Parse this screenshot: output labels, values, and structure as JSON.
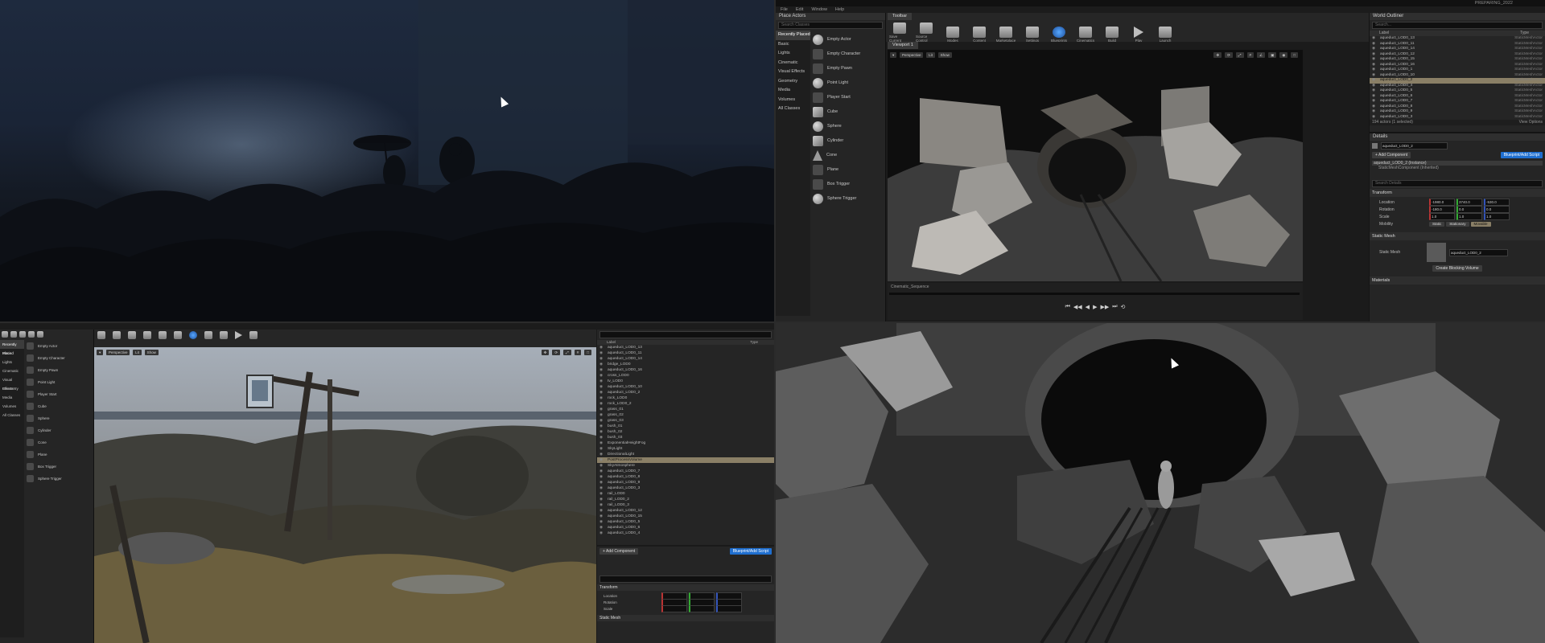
{
  "top_right": {
    "window_tab": "PREPARING_2022",
    "menu": [
      "File",
      "Edit",
      "Window",
      "Help"
    ],
    "place_actors": {
      "title": "Place Actors",
      "search_placeholder": "Search Classes",
      "categories": [
        "Recently Placed",
        "Basic",
        "Lights",
        "Cinematic",
        "Visual Effects",
        "Geometry",
        "Media",
        "Volumes",
        "All Classes"
      ],
      "selected_category": "Recently Placed",
      "items": [
        {
          "label": "Empty Actor",
          "icon": "actor"
        },
        {
          "label": "Empty Character",
          "icon": "character"
        },
        {
          "label": "Empty Pawn",
          "icon": "pawn"
        },
        {
          "label": "Point Light",
          "icon": "light"
        },
        {
          "label": "Player Start",
          "icon": "player"
        },
        {
          "label": "Cube",
          "icon": "cube"
        },
        {
          "label": "Sphere",
          "icon": "sphere"
        },
        {
          "label": "Cylinder",
          "icon": "cylinder"
        },
        {
          "label": "Cone",
          "icon": "cone"
        },
        {
          "label": "Plane",
          "icon": "plane"
        },
        {
          "label": "Box Trigger",
          "icon": "box"
        },
        {
          "label": "Sphere Trigger",
          "icon": "sphere"
        }
      ]
    },
    "toolbar": {
      "tab": "Toolbar",
      "buttons": [
        "Save Current",
        "Source Control",
        "Modes",
        "Content",
        "Marketplace",
        "Settings",
        "Blueprints",
        "Cinematics",
        "Build",
        "Play",
        "Launch"
      ]
    },
    "viewport": {
      "tab": "Viewport 1",
      "perspective": "Perspective",
      "lit": "Lit",
      "show": "Show",
      "sequence_name": "Cinematic_Sequence",
      "controls": [
        "⏮",
        "◀◀",
        "◀",
        "▶",
        "▶▶",
        "⏭",
        "⟲"
      ]
    },
    "outliner": {
      "title": "World Outliner",
      "search_placeholder": "Search...",
      "col_label": "Label",
      "col_type": "Type",
      "rows": [
        "aqueduct_LOD0_13",
        "aqueduct_LOD0_11",
        "aqueduct_LOD0_14",
        "aqueduct_LOD0_12",
        "aqueduct_LOD0_15",
        "aqueduct_LOD0_16",
        "aqueduct_LOD0_1",
        "aqueduct_LOD0_10",
        "aqueduct_LOD0_2",
        "aqueduct_LOD0_4",
        "aqueduct_LOD0_5",
        "aqueduct_LOD0_6",
        "aqueduct_LOD0_7",
        "aqueduct_LOD0_8",
        "aqueduct_LOD0_9",
        "aqueduct_LOD0_3"
      ],
      "row_type": "StaticMeshActor",
      "selected_index": 8,
      "footer": "194 actors (1 selected)",
      "view_options": "View Options"
    },
    "details": {
      "title": "Details",
      "actor_name": "aqueduct_LOD0_2",
      "add_component": "+ Add Component",
      "blueprint": "Blueprint/Add Script",
      "component_root": "aqueduct_LOD0_2 (Instance)",
      "component_child": "StaticMeshComponent (Inherited)",
      "search_placeholder": "Search Details",
      "transform_title": "Transform",
      "location_label": "Location",
      "rotation_label": "Rotation",
      "scale_label": "Scale",
      "mobility_label": "Mobility",
      "location": [
        "-1980.0",
        "3740.0",
        "-530.0"
      ],
      "rotation": [
        "-180.0",
        "0.0",
        "0.0"
      ],
      "scale": [
        "1.0",
        "1.0",
        "1.0"
      ],
      "mobility_options": [
        "Static",
        "Stationary",
        "Movable"
      ],
      "static_mesh_title": "Static Mesh",
      "static_mesh_label": "Static Mesh",
      "static_mesh_value": "aqueduct_LOD0_2",
      "create_blocking": "Create Blocking Volume",
      "materials_title": "Materials"
    }
  },
  "bottom_left": {
    "categories": [
      "Recently Placed",
      "Basic",
      "Lights",
      "Cinematic",
      "Visual Effects",
      "Geometry",
      "Media",
      "Volumes",
      "All Classes"
    ],
    "items": [
      "Empty Actor",
      "Empty Character",
      "Empty Pawn",
      "Point Light",
      "Player Start",
      "Cube",
      "Sphere",
      "Cylinder",
      "Cone",
      "Plane",
      "Box Trigger",
      "Sphere Trigger"
    ],
    "viewport_perspective": "Perspective",
    "viewport_lit": "Lit",
    "viewport_show": "Show",
    "outliner_col_label": "Label",
    "outliner_col_type": "Type",
    "outliner_rows": [
      "aqueduct_LOD0_13",
      "aqueduct_LOD0_11",
      "aqueduct_LOD0_14",
      "bridge_LOD0",
      "aqueduct_LOD0_16",
      "cross_LOD0",
      "tv_LOD0",
      "aqueduct_LOD0_10",
      "aqueduct_LOD0_2",
      "rock_LOD0",
      "rock_LOD0_2",
      "grass_01",
      "grass_02",
      "grass_03",
      "bush_01",
      "bush_02",
      "bush_03",
      "ExponentialHeightFog",
      "SkyLight",
      "DirectionalLight",
      "PostProcessVolume",
      "SkyAtmosphere",
      "aqueduct_LOD0_7",
      "aqueduct_LOD0_8",
      "aqueduct_LOD0_9",
      "aqueduct_LOD0_3",
      "rail_LOD0",
      "rail_LOD0_2",
      "rail_LOD0_3",
      "aqueduct_LOD0_12",
      "aqueduct_LOD0_15",
      "aqueduct_LOD0_5",
      "aqueduct_LOD0_6",
      "aqueduct_LOD0_4"
    ],
    "outliner_selected_index": 20,
    "add_component": "+ Add Component",
    "blueprint": "Blueprint/Add Script",
    "transform_title": "Transform",
    "location_label": "Location",
    "rotation_label": "Rotation",
    "scale_label": "Scale",
    "static_mesh_title": "Static Mesh"
  }
}
